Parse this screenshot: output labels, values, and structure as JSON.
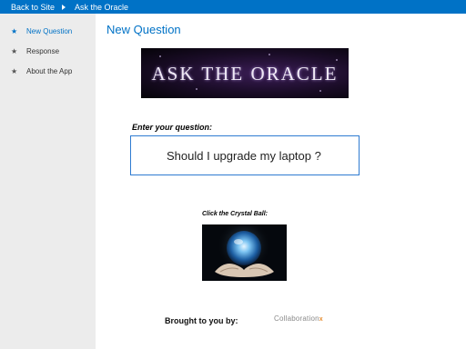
{
  "topbar": {
    "back_label": "Back to Site",
    "app_title": "Ask the Oracle"
  },
  "sidebar": {
    "items": [
      {
        "label": "New Question",
        "icon": "star-icon",
        "active": true
      },
      {
        "label": "Response",
        "icon": "star-icon",
        "active": false
      },
      {
        "label": "About the App",
        "icon": "star-icon",
        "active": false
      }
    ]
  },
  "main": {
    "title": "New Question",
    "banner_text": "ASK THE ORACLE",
    "question_label": "Enter your question:",
    "question_value": "Should I upgrade my laptop ?",
    "crystal_label": "Click the Crystal Ball:",
    "brought_label": "Brought to you by:",
    "sponsor_logo_text": "Collaboration",
    "sponsor_logo_mark": "x"
  },
  "colors": {
    "accent": "#0072c6",
    "sidebar_bg": "#ececec"
  }
}
